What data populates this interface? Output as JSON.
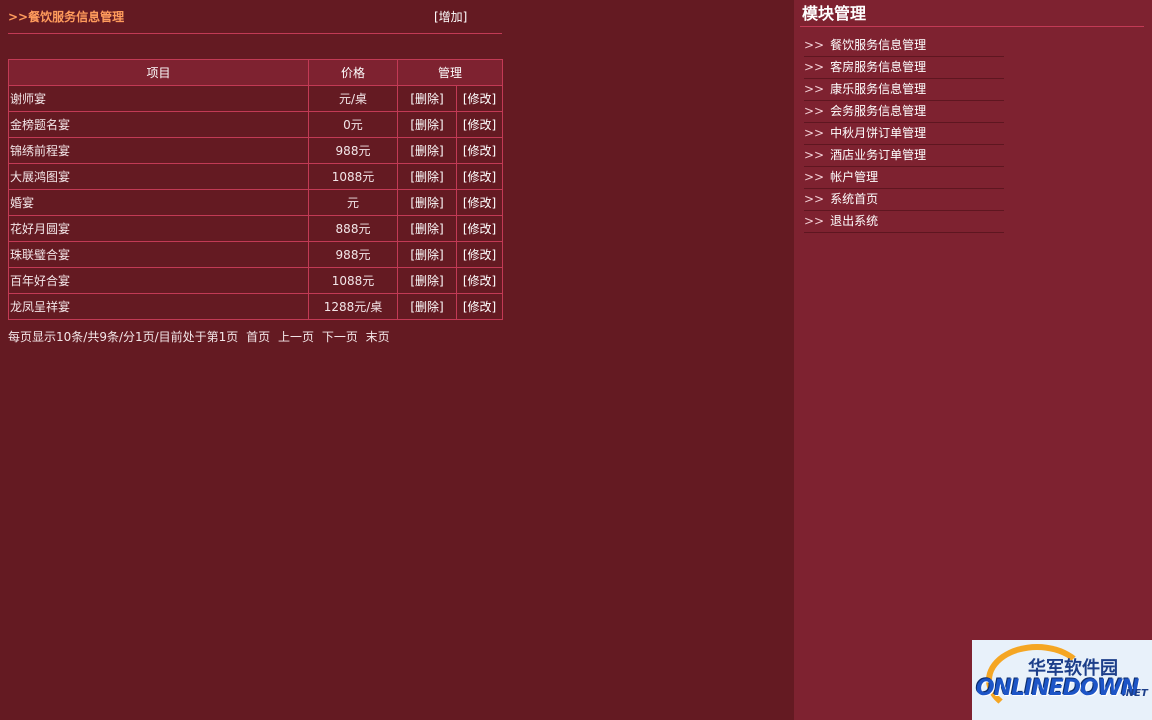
{
  "main": {
    "section_title": ">>餐饮服务信息管理",
    "add_label": "[增加]",
    "table": {
      "headers": [
        "项目",
        "价格",
        "管理"
      ],
      "rows": [
        {
          "name": "谢师宴",
          "price": "元/桌",
          "delete": "[删除]",
          "edit": "[修改]"
        },
        {
          "name": "金榜题名宴",
          "price": "0元",
          "delete": "[删除]",
          "edit": "[修改]"
        },
        {
          "name": "锦绣前程宴",
          "price": "988元",
          "delete": "[删除]",
          "edit": "[修改]"
        },
        {
          "name": "大展鸿图宴",
          "price": "1088元",
          "delete": "[删除]",
          "edit": "[修改]"
        },
        {
          "name": "婚宴",
          "price": "元",
          "delete": "[删除]",
          "edit": "[修改]"
        },
        {
          "name": "花好月圆宴",
          "price": "888元",
          "delete": "[删除]",
          "edit": "[修改]"
        },
        {
          "name": "珠联璧合宴",
          "price": "988元",
          "delete": "[删除]",
          "edit": "[修改]"
        },
        {
          "name": "百年好合宴",
          "price": "1088元",
          "delete": "[删除]",
          "edit": "[修改]"
        },
        {
          "name": "龙凤呈祥宴",
          "price": "1288元/桌",
          "delete": "[删除]",
          "edit": "[修改]"
        }
      ]
    },
    "pager": {
      "info": "每页显示10条/共9条/分1页/目前处于第1页",
      "first": "首页",
      "prev": "上一页",
      "next": "下一页",
      "last": "末页"
    }
  },
  "sidebar": {
    "title": "模块管理",
    "arrow": ">>",
    "items": [
      "餐饮服务信息管理",
      "客房服务信息管理",
      "康乐服务信息管理",
      "会务服务信息管理",
      "中秋月饼订单管理",
      "酒店业务订单管理",
      "帐户管理",
      "系统首页",
      "退出系统"
    ]
  },
  "watermark": {
    "cn": "华军软件园",
    "en": "ONLINEDOWN",
    "net": ".NET"
  },
  "colors": {
    "background": "#641a22",
    "sidebar": "#7e2230",
    "border": "#c23a55",
    "title_accent": "#ff9b5c"
  }
}
